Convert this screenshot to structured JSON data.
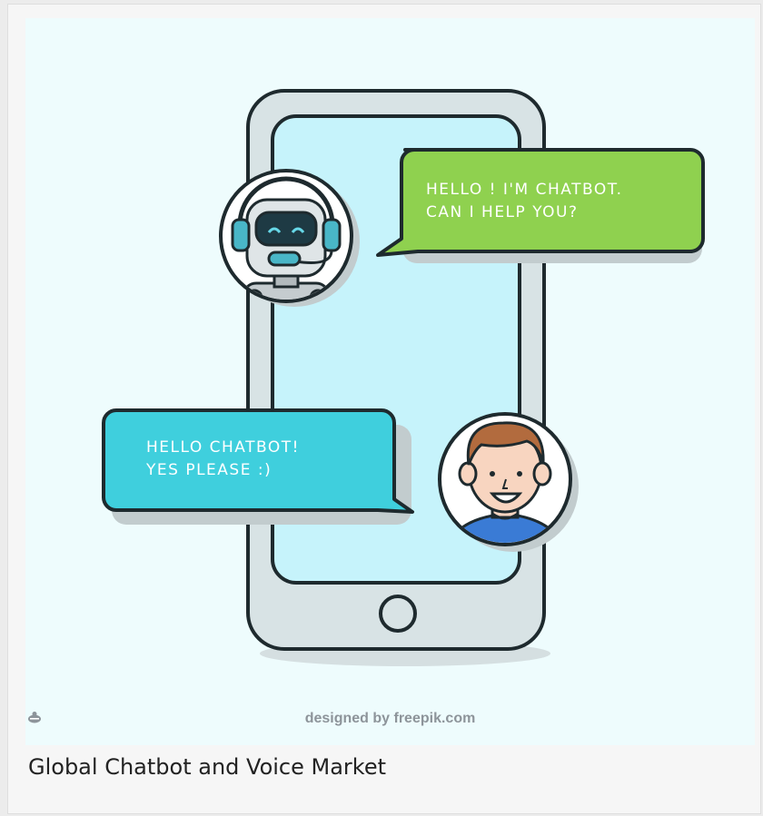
{
  "illustration": {
    "bot_message": [
      "HELLO ! I'M CHATBOT.",
      "CAN I HELP YOU?"
    ],
    "user_message": [
      "HELLO CHATBOT!",
      "YES PLEASE :)"
    ],
    "credit_prefix": "designed by",
    "credit_brand": "freepik.com"
  },
  "caption": "Global Chatbot and Voice Market",
  "colors": {
    "background": "#eefcfd",
    "phone_body": "#d8e3e5",
    "phone_screen": "#c6f3fb",
    "bot_bubble": "#8fd14f",
    "user_bubble": "#3fcfdd",
    "outline": "#1e2a2e"
  }
}
